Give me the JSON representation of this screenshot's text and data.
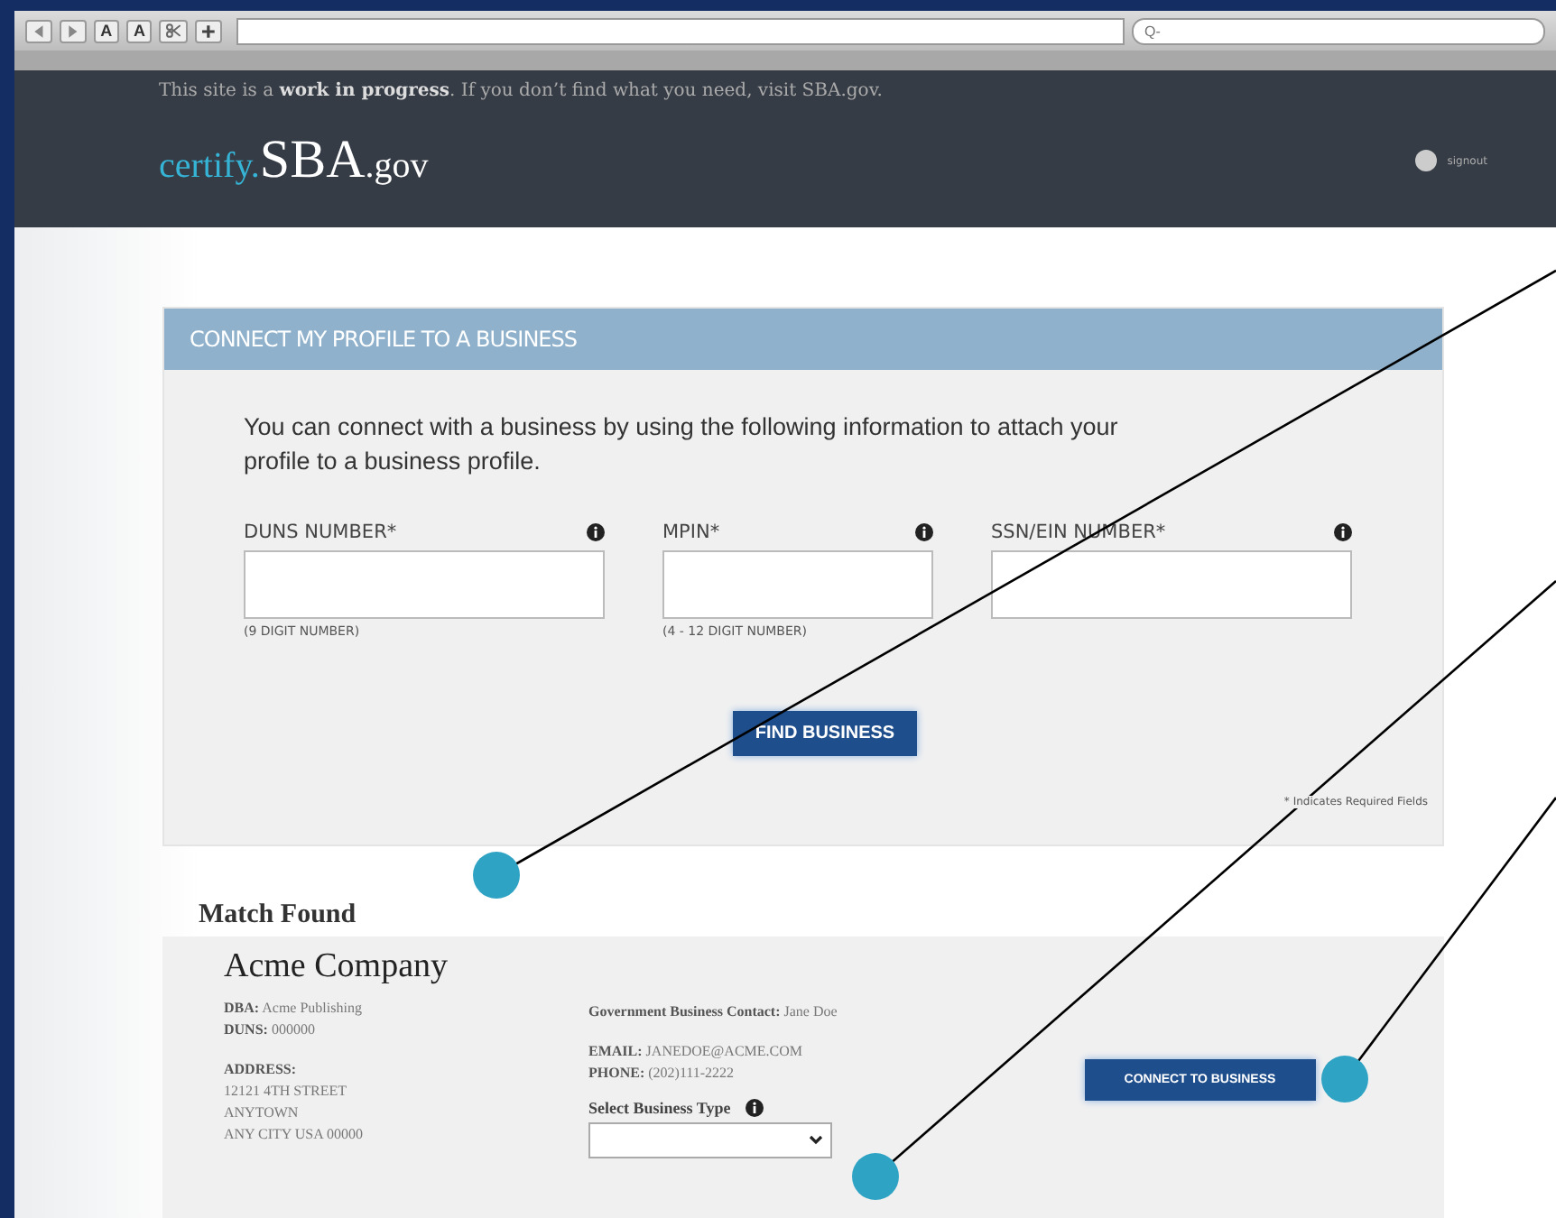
{
  "browser": {
    "toolbar_buttons": [
      {
        "kind": "back"
      },
      {
        "kind": "forward"
      },
      {
        "kind": "text",
        "label": "A"
      },
      {
        "kind": "text",
        "label": "A"
      },
      {
        "kind": "scissors"
      },
      {
        "kind": "add"
      }
    ],
    "search": {
      "placeholder": "Q-"
    }
  },
  "banner": {
    "text": "This site is a **work in progress**. If you don’t find what you need, visit SBA.gov."
  },
  "logo": {
    "prefix": "certify.",
    "main": "SBA",
    "suffix": ".gov"
  },
  "user": {
    "label": "signout"
  },
  "connect_panel": {
    "title": "CONNECT MY PROFILE TO A BUSINESS",
    "intro": "You can connect with a business by using the following information to attach your profile to a business profile.",
    "fields": [
      {
        "label": "DUNS NUMBER*",
        "hint": "(9 DIGIT NUMBER)"
      },
      {
        "label": "MPIN*",
        "hint": "(4 - 12 DIGIT NUMBER)"
      },
      {
        "label": "SSN/EIN NUMBER*"
      }
    ],
    "button": "FIND BUSINESS",
    "required_note": "* Indicates Required Fields"
  },
  "match": {
    "heading": "Match Found",
    "company": "Acme Company",
    "details": [
      {
        "key": "DBA:",
        "value": "Acme Publishing"
      },
      {
        "key": "DUNS:",
        "value": "000000"
      }
    ],
    "address_label": "ADDRESS:",
    "address_lines": [
      "12121 4TH STREET",
      "ANYTOWN",
      "ANY CITY USA 00000"
    ],
    "contact": {
      "key": "Government Business Contact:",
      "value": "Jane Doe"
    },
    "email": {
      "key": "EMAIL:",
      "value": "JANEDOE@ACME.COM"
    },
    "phone": {
      "key": "PHONE:",
      "value": "(202)111-2222"
    },
    "select_label": "Select Business Type",
    "button": "CONNECT TO BUSINESS"
  }
}
